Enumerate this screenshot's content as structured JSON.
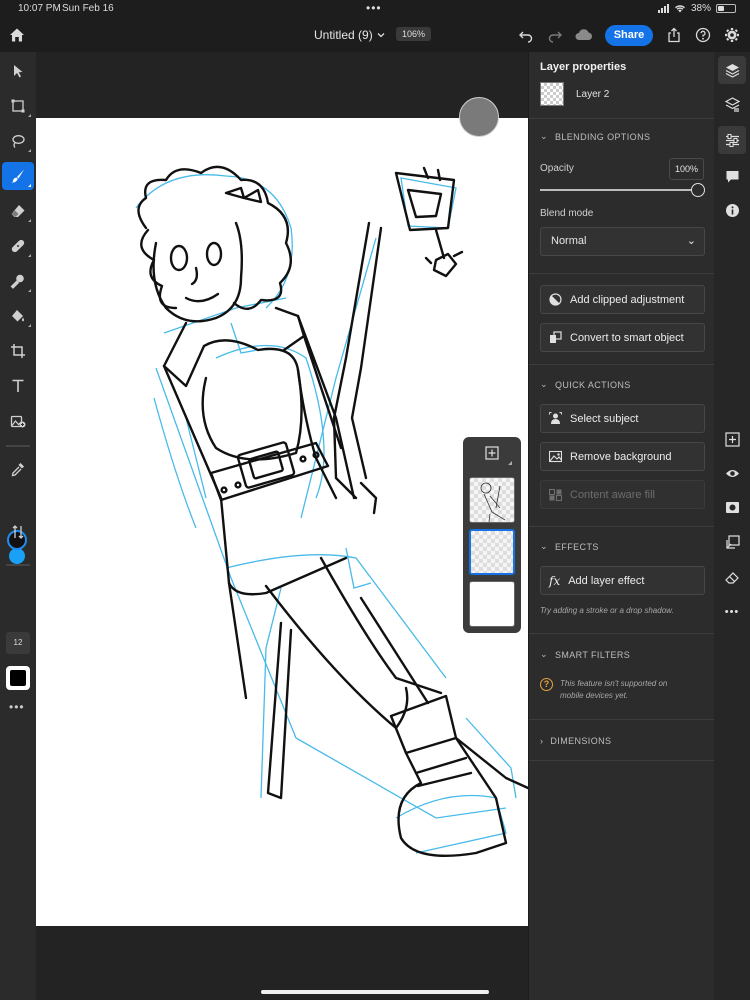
{
  "status": {
    "time": "10:07 PM",
    "date": "Sun Feb 16",
    "battery": "38%"
  },
  "topbar": {
    "title": "Untitled (9)",
    "zoom": "106%",
    "share_label": "Share"
  },
  "lefttools": {
    "brush_size": "12"
  },
  "colors": {
    "accent": "#1473e6",
    "foreground": "#000000",
    "background": "#1aa0f7",
    "sketch_blue": "#29aee6"
  },
  "props": {
    "title": "Layer properties",
    "layer_name": "Layer 2",
    "blending": {
      "header": "BLENDING OPTIONS",
      "opacity_label": "Opacity",
      "opacity_value": "100%",
      "blend_mode_label": "Blend mode",
      "blend_mode": "Normal"
    },
    "add_clipped_adjustment": "Add clipped adjustment",
    "convert_smart_object": "Convert to smart object",
    "quick_actions": {
      "header": "QUICK ACTIONS",
      "select_subject": "Select subject",
      "remove_background": "Remove background",
      "content_aware_fill": "Content aware fill"
    },
    "effects": {
      "header": "EFFECTS",
      "add_layer_effect": "Add layer effect",
      "hint": "Try adding a stroke or a drop shadow."
    },
    "smart_filters": {
      "header": "SMART FILTERS",
      "warning": "This feature isn't supported on mobile devices yet."
    },
    "dimensions": {
      "header": "DIMENSIONS"
    }
  },
  "layers": [
    {
      "id": "layer-3",
      "selected": false,
      "type": "sketch"
    },
    {
      "id": "layer-2",
      "selected": true,
      "type": "transparent"
    },
    {
      "id": "layer-1",
      "selected": false,
      "type": "white"
    }
  ]
}
